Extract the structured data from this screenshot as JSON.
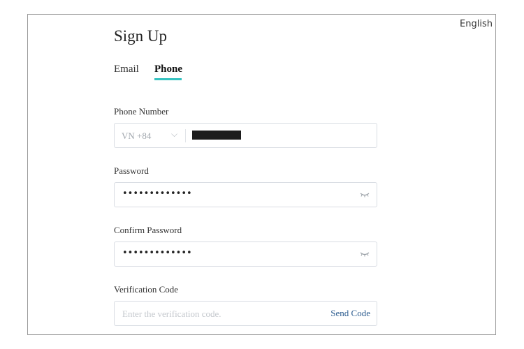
{
  "header": {
    "language": "English"
  },
  "page": {
    "title": "Sign Up"
  },
  "tabs": [
    {
      "label": "Email",
      "active": false
    },
    {
      "label": "Phone",
      "active": true
    }
  ],
  "phone": {
    "label": "Phone Number",
    "country_code": "VN +84",
    "value_masked": true
  },
  "password": {
    "label": "Password",
    "value": "•••••••••••••",
    "toggle_icon": "eye-closed-icon"
  },
  "confirm_password": {
    "label": "Confirm Password",
    "value": "•••••••••••••",
    "toggle_icon": "eye-closed-icon"
  },
  "verification": {
    "label": "Verification Code",
    "placeholder": "Enter the verification code.",
    "send_label": "Send Code"
  },
  "colors": {
    "accent": "#34c2c0",
    "link": "#2c5c8f",
    "border": "#d9dde3"
  }
}
